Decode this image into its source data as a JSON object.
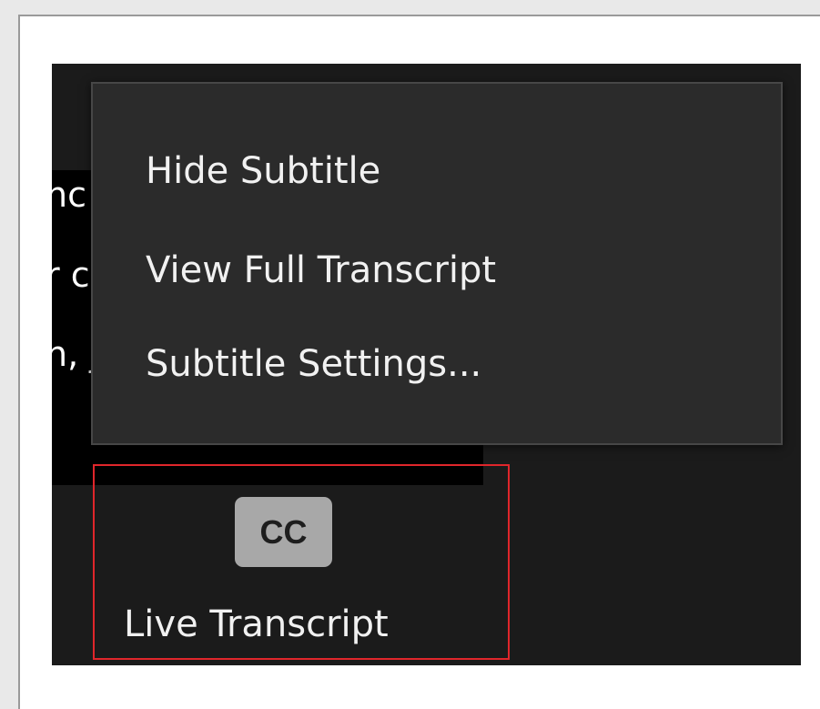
{
  "subtitle": {
    "line1": "nc",
    "line2": "r c",
    "line3": "n, j"
  },
  "menu": {
    "items": [
      {
        "label": "Hide Subtitle"
      },
      {
        "label": "View Full Transcript"
      },
      {
        "label": "Subtitle Settings..."
      }
    ]
  },
  "toolbar": {
    "cc_badge": "CC",
    "live_transcript_label": "Live Transcript"
  },
  "colors": {
    "app_background": "#1b1b1b",
    "menu_background": "#2b2b2b",
    "highlight_border": "#e0262b",
    "cc_badge_background": "#a8a8a8"
  }
}
